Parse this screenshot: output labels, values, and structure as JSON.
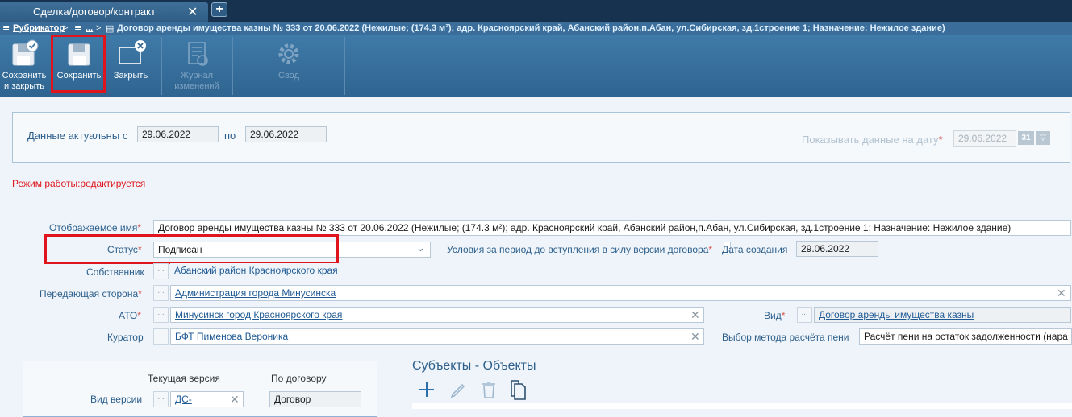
{
  "tab": {
    "title": "Сделка/договор/контракт",
    "close": "✕",
    "add": "+"
  },
  "breadcrumb": {
    "rubricator": "Рубрикатор",
    "sep1": ">",
    "ellipsis": "...",
    "sep2": ">",
    "document": "Договор аренды имущества казны № 333 от 20.06.2022 (Нежилые; (174.3 м²); адр. Красноярский край, Абанский район,п.Абан, ул.Сибирская, зд.1строение 1; Назначение: Нежилое здание)"
  },
  "ribbon": {
    "save_close_1": "Сохранить",
    "save_close_2": "и закрыть",
    "save": "Сохранить",
    "close": "Закрыть",
    "journal_1": "Журнал",
    "journal_2": "изменений",
    "summary": "Свод"
  },
  "actual": {
    "label": "Данные актуальны с",
    "from": "29.06.2022",
    "to_label": "по",
    "to": "29.06.2022",
    "show_label": "Показывать данные на дату",
    "show_date": "29.06.2022",
    "cal_day": "31"
  },
  "mode_text": "Режим работы:редактируется",
  "form": {
    "display_name_label": "Отображаемое имя",
    "display_name": "Договор аренды имущества казны № 333 от 20.06.2022 (Нежилые; (174.3 м²); адр. Красноярский край, Абанский район,п.Абан, ул.Сибирская, зд.1строение 1; Назначение: Нежилое здание)",
    "status_label": "Статус",
    "status": "Подписан",
    "conditions_label": "Условия за период до вступления в силу версии договора",
    "created_label": "Дата создания",
    "created": "29.06.2022",
    "owner_label": "Собственник",
    "owner": "Абанский район Красноярского края",
    "transfer_label": "Передающая сторона",
    "transfer": "Администрация города Минусинска",
    "ato_label": "АТО",
    "ato": "Минусинск город Красноярского края",
    "kind_label": "Вид",
    "kind": "Договор аренды имущества казны",
    "curator_label": "Куратор",
    "curator": "БФТ Пименова Вероника",
    "penalty_label": "Выбор метода расчёта пени",
    "penalty": "Расчёт пени на остаток задолженности (нара",
    "req": "*",
    "dots": "...",
    "clear": "✕"
  },
  "version": {
    "current_label": "Текущая версия",
    "by_contract_label": "По договору",
    "kind_label": "Вид версии",
    "current_value": "ДС-",
    "by_contract_value": "Договор"
  },
  "subjects": {
    "title": "Субъекты - Объекты"
  },
  "colors": {
    "red_highlight": "#e0141c",
    "ribbon": "#2f6490",
    "tabbar": "#16324f"
  }
}
